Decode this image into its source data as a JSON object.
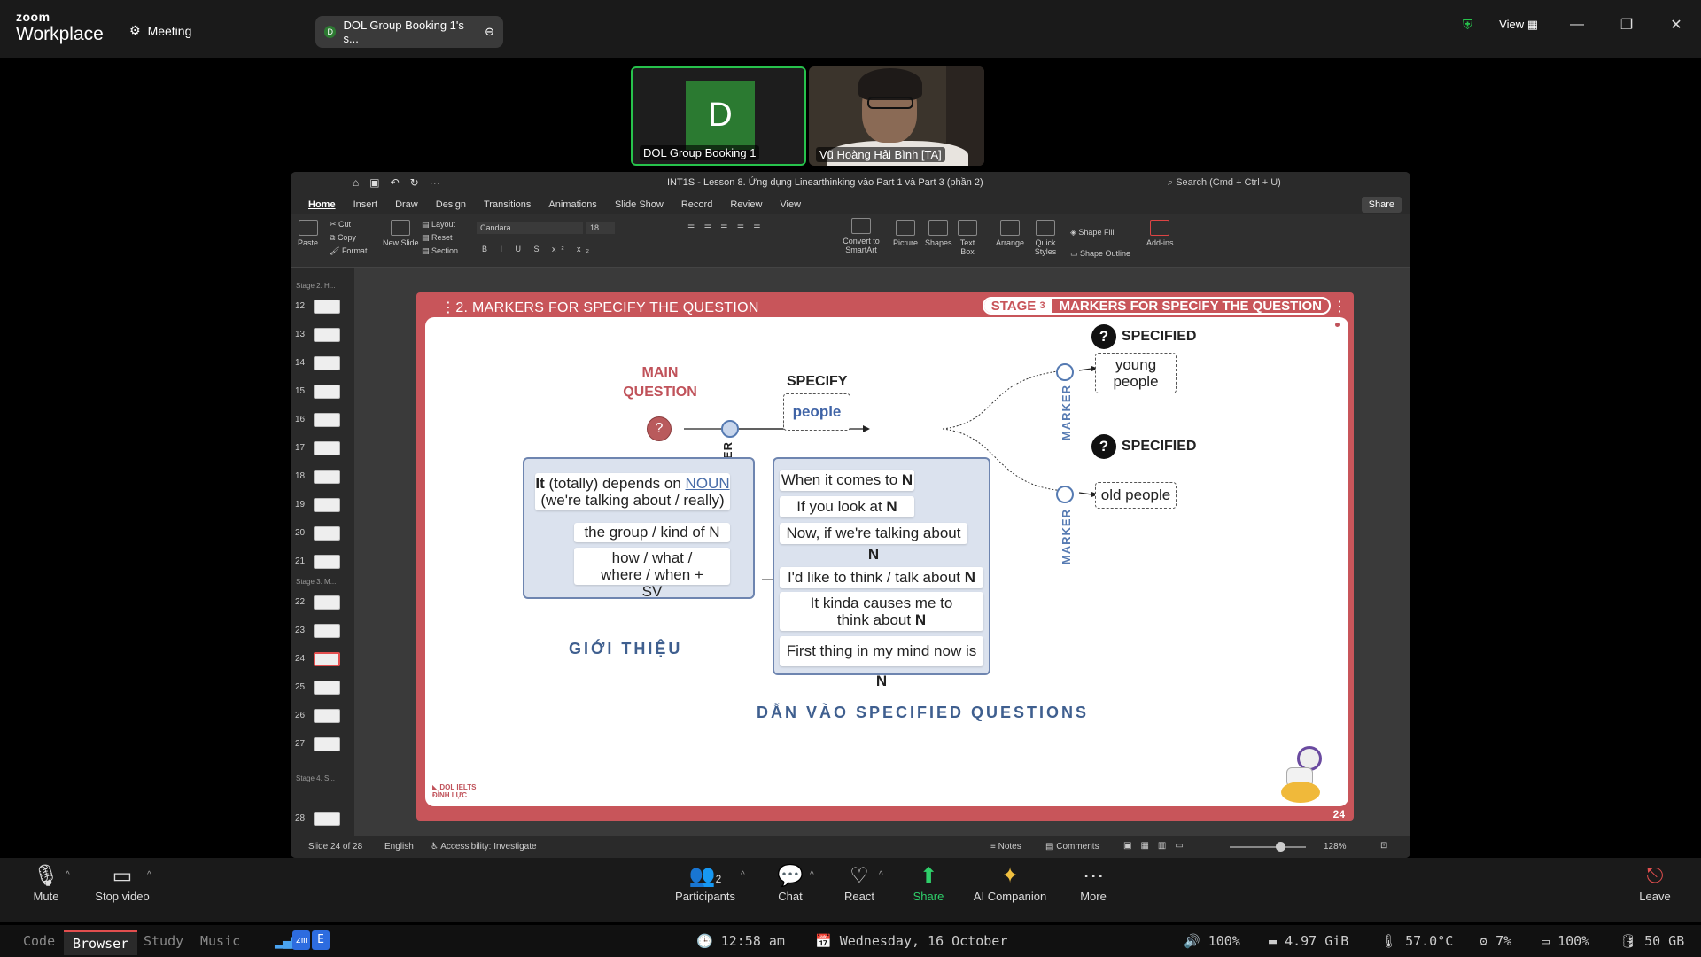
{
  "zoom": {
    "brand_top": "zoom",
    "brand_bottom": "Workplace",
    "meeting_menu": "Meeting",
    "meeting_tab": "DOL Group Booking 1's s...",
    "meeting_tab_initial": "D",
    "view_label": "View"
  },
  "participants": [
    {
      "name": "DOL Group Booking 1",
      "initial": "D"
    },
    {
      "name": "Vũ Hoàng Hải Bình [TA]"
    }
  ],
  "ppt": {
    "title": "INT1S - Lesson 8. Ứng dụng Linearthinking vào Part 1 và Part 3 (phần 2)",
    "search_placeholder": "Search (Cmd + Ctrl + U)",
    "tabs": [
      "Home",
      "Insert",
      "Draw",
      "Design",
      "Transitions",
      "Animations",
      "Slide Show",
      "Record",
      "Review",
      "View"
    ],
    "share": "Share",
    "ribbon": {
      "paste": "Paste",
      "cut": "Cut",
      "copy": "Copy",
      "format": "Format",
      "new_slide": "New Slide",
      "layout": "Layout",
      "reset": "Reset",
      "section": "Section",
      "font": "Candara",
      "size": "18",
      "convert": "Convert to SmartArt",
      "picture": "Picture",
      "shapes": "Shapes",
      "textbox": "Text Box",
      "arrange": "Arrange",
      "quick_styles": "Quick Styles",
      "shape_fill": "Shape Fill",
      "shape_outline": "Shape Outline",
      "addins": "Add-ins"
    },
    "sections": [
      "Stage 2. H...",
      "Stage 3. M...",
      "Stage 4. S..."
    ],
    "slides": [
      "12",
      "13",
      "14",
      "15",
      "16",
      "17",
      "18",
      "19",
      "20",
      "21",
      "22",
      "23",
      "24",
      "25",
      "26",
      "27",
      "28"
    ],
    "selected_slide": "24",
    "status": {
      "slide_of": "Slide 24 of 28",
      "language": "English",
      "accessibility": "Accessibility: Investigate",
      "notes": "Notes",
      "comments": "Comments",
      "zoom": "128%"
    }
  },
  "slide": {
    "header_left": "2. MARKERS FOR SPECIFY THE QUESTION",
    "stage_word": "STAGE",
    "stage_num": "3",
    "stage_title": "MARKERS FOR SPECIFY THE QUESTION",
    "main_question": "MAIN QUESTION",
    "q_mark": "?",
    "specify": "SPECIFY",
    "people": "people",
    "marker": "MARKER",
    "specified": "SPECIFIED",
    "young_people": "young people",
    "old_people": "old people",
    "left_panel": {
      "line1_bold": "It",
      "line1_rest": " (totally) depends on ",
      "noun": "NOUN",
      "line2": "(we're talking about / really)",
      "box2": "the group / kind of N",
      "box3": "how / what / where / when + SV"
    },
    "right_panel": [
      {
        "text": "When it comes to ",
        "bold": "N"
      },
      {
        "text": "If you look at ",
        "bold": "N"
      },
      {
        "text": "Now, if we're talking about ",
        "bold": "N"
      },
      {
        "text": "I'd like to think / talk about ",
        "bold": "N"
      },
      {
        "text": "It kinda causes me to think about ",
        "bold": "N"
      },
      {
        "text": "First thing in my mind now is ",
        "bold": "N"
      }
    ],
    "caption_left": "GIỚI THIỆU",
    "caption_right": "DẪN VÀO SPECIFIED QUESTIONS",
    "logo": "DOL IELTS ĐÌNH LỰC",
    "page_num": "24"
  },
  "toolbar": {
    "mute": "Mute",
    "stop_video": "Stop video",
    "participants": "Participants",
    "participants_count": "2",
    "chat": "Chat",
    "react": "React",
    "share": "Share",
    "ai": "AI Companion",
    "more": "More",
    "leave": "Leave"
  },
  "osbar": {
    "workspaces": [
      "Code",
      "Browser",
      "Study",
      "Music"
    ],
    "active": "Browser",
    "time": "12:58 am",
    "date": "Wednesday, 16 October",
    "volume": "100%",
    "memory": "4.97 GiB",
    "temp": "57.0°C",
    "cpu": "7%",
    "battery": "100%",
    "disk": "50 GB"
  }
}
